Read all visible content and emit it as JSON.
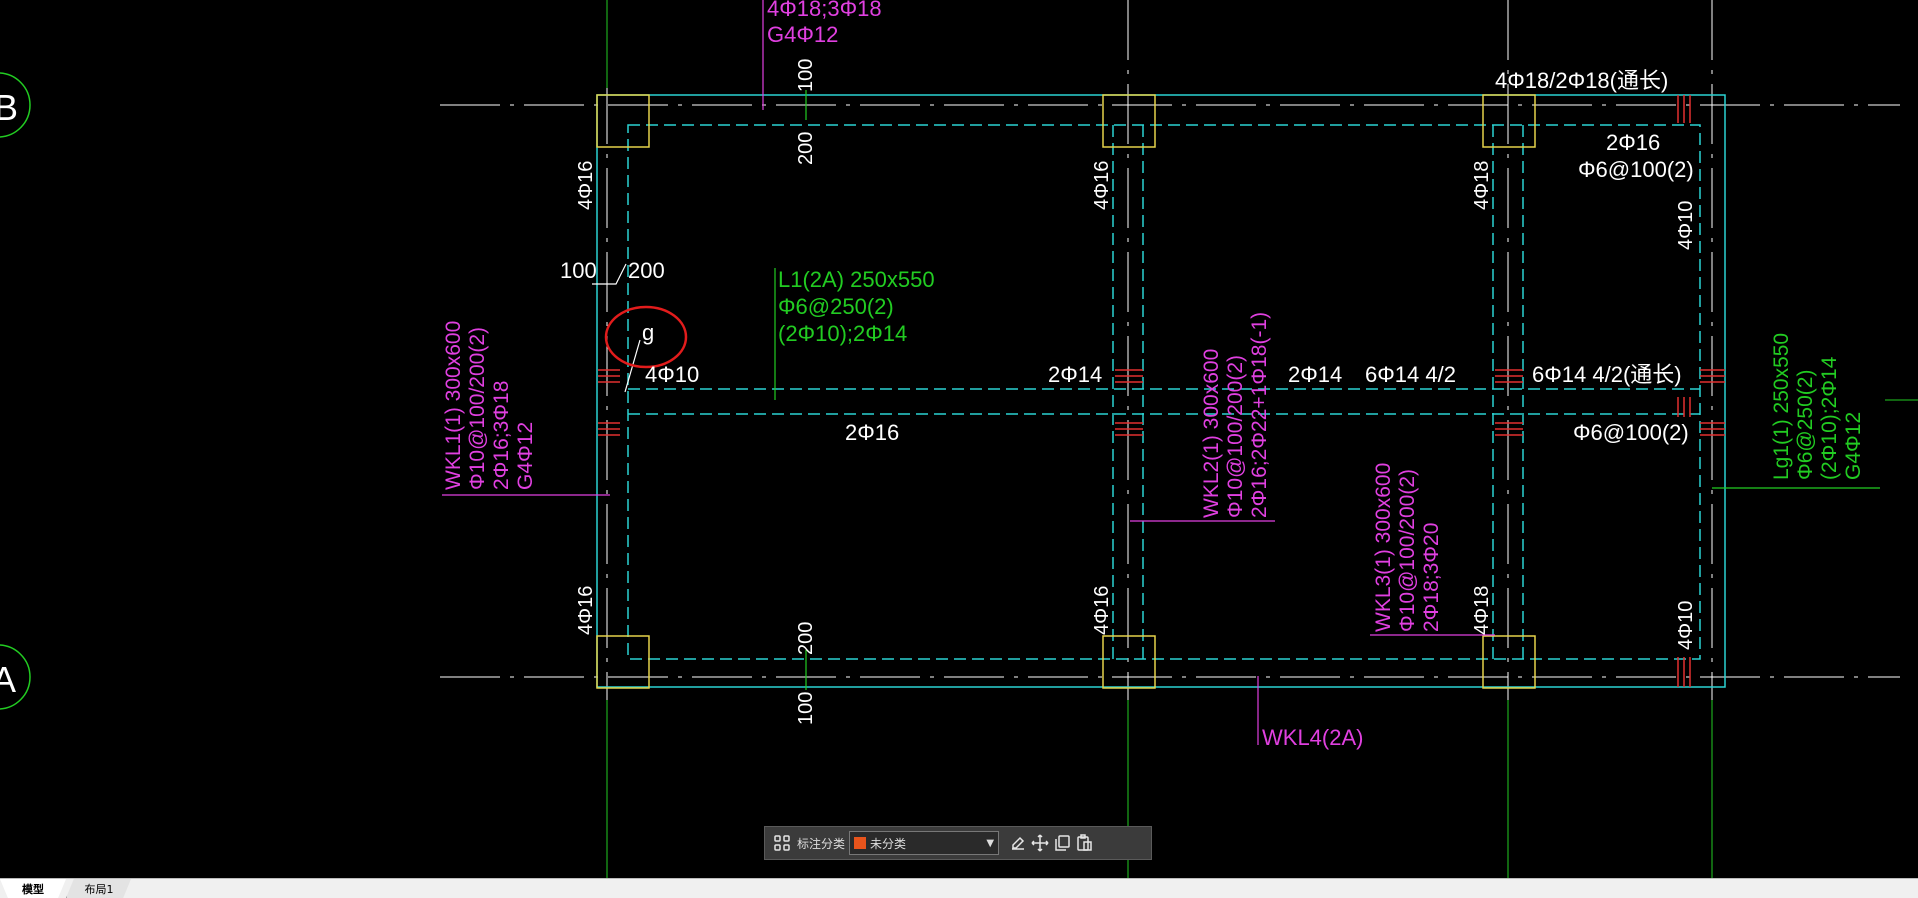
{
  "drawing": {
    "labels": {
      "top_note1": "4Φ18;3Φ18",
      "top_note2": "G4Φ12",
      "dim_100_top": "100",
      "dim_200_top": "200",
      "top_right_note": "4Φ18/2Φ18(通长)",
      "right_2phi16": "2Φ16",
      "right_phi6": "Φ6@100(2)",
      "col_4phi16_left": "4Φ16",
      "col_4phi16_mid": "4Φ16",
      "col_4phi18_right": "4Φ18",
      "col_4phi10_far": "4Φ10",
      "dim_100_left": "100",
      "dim_200_left": "200",
      "circle_g": "g",
      "l1_title": "L1(2A) 250x550",
      "l1_stirrup": "Φ6@250(2)",
      "l1_bars": "(2Φ10);2Φ14",
      "left_4phi10": "4Φ10",
      "mid_2phi14": "2Φ14",
      "mid_2phi16": "2Φ16",
      "right_2phi14": "2Φ14",
      "right_6phi14": "6Φ14 4/2",
      "far_6phi14": "6Φ14 4/2(通长)",
      "far_phi6": "Φ6@100(2)",
      "wkl1_title": "WKL1(1) 300x600",
      "wkl1_stirrup": "Φ10@100/200(2)",
      "wkl1_bars": "2Φ16;3Φ18",
      "wkl1_g": "G4Φ12",
      "wkl2_title": "WKL2(1) 300x600",
      "wkl2_stirrup": "Φ10@100/200(2)",
      "wkl2_bars": "2Φ16;2Φ22+1Φ18(-1)",
      "wkl3_title": "WKL3(1) 300x600",
      "wkl3_stirrup": "Φ10@100/200(2)",
      "wkl3_bars": "2Φ18;3Φ20",
      "lg1_title": "Lg1(1) 250x550",
      "lg1_stirrup": "Φ6@250(2)",
      "lg1_bars": "(2Φ10);2Φ14",
      "lg1_g": "G4Φ12",
      "bot_4phi16_left": "4Φ16",
      "bot_4phi16_mid": "4Φ16",
      "bot_4phi18": "4Φ18",
      "bot_4phi10": "4Φ10",
      "dim_200_bot": "200",
      "dim_100_bot": "100",
      "wkl4": "WKL4(2A)",
      "axis_b": "B",
      "axis_a": "A"
    },
    "colors": {
      "beam": "#2ad3d3",
      "column": "#e6d34a",
      "axis": "#ffffff",
      "grid_green": "#22cc22",
      "annotation_magenta": "#e040e0",
      "annotation_green": "#22cc22",
      "rebar_red": "#e23030",
      "highlight_circle": "#e21c1c",
      "text_white": "#ffffff"
    }
  },
  "toolbar": {
    "layout_icon": "grid-icon",
    "label": "标注分类",
    "selected_value": "未分类",
    "selected_color": "#e8541c",
    "icons": [
      "edit-icon",
      "move-icon",
      "copy-icon",
      "paste-icon"
    ]
  },
  "tabs": {
    "model": "模型",
    "layout1": "布局1"
  }
}
